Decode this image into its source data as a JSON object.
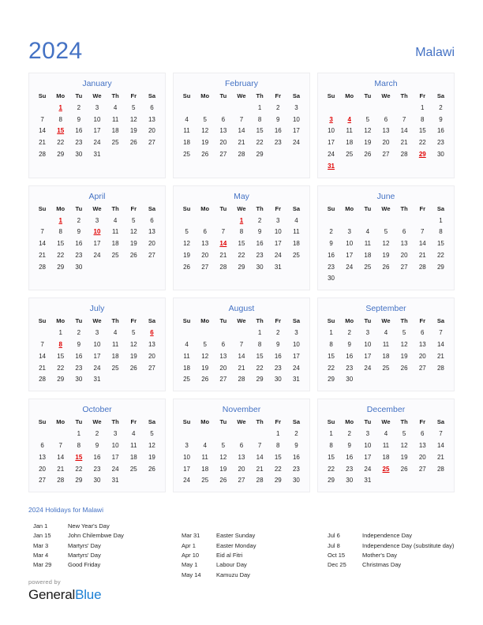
{
  "header": {
    "year": "2024",
    "country": "Malawi"
  },
  "colors": {
    "accent_blue": "#4472c4",
    "holiday_red": "#e00000",
    "brand_blue": "#1b7fd4",
    "card_bg": "#fbfbfd",
    "card_border": "#ededf0"
  },
  "weekday_headers": [
    "Su",
    "Mo",
    "Tu",
    "We",
    "Th",
    "Fr",
    "Sa"
  ],
  "months": [
    {
      "name": "January",
      "weeks": [
        [
          "",
          "1",
          "2",
          "3",
          "4",
          "5",
          "6"
        ],
        [
          "7",
          "8",
          "9",
          "10",
          "11",
          "12",
          "13"
        ],
        [
          "14",
          "15",
          "16",
          "17",
          "18",
          "19",
          "20"
        ],
        [
          "21",
          "22",
          "23",
          "24",
          "25",
          "26",
          "27"
        ],
        [
          "28",
          "29",
          "30",
          "31",
          "",
          "",
          ""
        ]
      ],
      "holidays": [
        "1",
        "15"
      ]
    },
    {
      "name": "February",
      "weeks": [
        [
          "",
          "",
          "",
          "",
          "1",
          "2",
          "3"
        ],
        [
          "4",
          "5",
          "6",
          "7",
          "8",
          "9",
          "10"
        ],
        [
          "11",
          "12",
          "13",
          "14",
          "15",
          "16",
          "17"
        ],
        [
          "18",
          "19",
          "20",
          "21",
          "22",
          "23",
          "24"
        ],
        [
          "25",
          "26",
          "27",
          "28",
          "29",
          "",
          ""
        ]
      ],
      "holidays": []
    },
    {
      "name": "March",
      "weeks": [
        [
          "",
          "",
          "",
          "",
          "",
          "1",
          "2"
        ],
        [
          "3",
          "4",
          "5",
          "6",
          "7",
          "8",
          "9"
        ],
        [
          "10",
          "11",
          "12",
          "13",
          "14",
          "15",
          "16"
        ],
        [
          "17",
          "18",
          "19",
          "20",
          "21",
          "22",
          "23"
        ],
        [
          "24",
          "25",
          "26",
          "27",
          "28",
          "29",
          "30"
        ],
        [
          "31",
          "",
          "",
          "",
          "",
          "",
          ""
        ]
      ],
      "holidays": [
        "3",
        "4",
        "29",
        "31"
      ]
    },
    {
      "name": "April",
      "weeks": [
        [
          "",
          "1",
          "2",
          "3",
          "4",
          "5",
          "6"
        ],
        [
          "7",
          "8",
          "9",
          "10",
          "11",
          "12",
          "13"
        ],
        [
          "14",
          "15",
          "16",
          "17",
          "18",
          "19",
          "20"
        ],
        [
          "21",
          "22",
          "23",
          "24",
          "25",
          "26",
          "27"
        ],
        [
          "28",
          "29",
          "30",
          "",
          "",
          "",
          ""
        ]
      ],
      "holidays": [
        "1",
        "10"
      ]
    },
    {
      "name": "May",
      "weeks": [
        [
          "",
          "",
          "",
          "1",
          "2",
          "3",
          "4"
        ],
        [
          "5",
          "6",
          "7",
          "8",
          "9",
          "10",
          "11"
        ],
        [
          "12",
          "13",
          "14",
          "15",
          "16",
          "17",
          "18"
        ],
        [
          "19",
          "20",
          "21",
          "22",
          "23",
          "24",
          "25"
        ],
        [
          "26",
          "27",
          "28",
          "29",
          "30",
          "31",
          ""
        ]
      ],
      "holidays": [
        "1",
        "14"
      ]
    },
    {
      "name": "June",
      "weeks": [
        [
          "",
          "",
          "",
          "",
          "",
          "",
          "1"
        ],
        [
          "2",
          "3",
          "4",
          "5",
          "6",
          "7",
          "8"
        ],
        [
          "9",
          "10",
          "11",
          "12",
          "13",
          "14",
          "15"
        ],
        [
          "16",
          "17",
          "18",
          "19",
          "20",
          "21",
          "22"
        ],
        [
          "23",
          "24",
          "25",
          "26",
          "27",
          "28",
          "29"
        ],
        [
          "30",
          "",
          "",
          "",
          "",
          "",
          ""
        ]
      ],
      "holidays": []
    },
    {
      "name": "July",
      "weeks": [
        [
          "",
          "1",
          "2",
          "3",
          "4",
          "5",
          "6"
        ],
        [
          "7",
          "8",
          "9",
          "10",
          "11",
          "12",
          "13"
        ],
        [
          "14",
          "15",
          "16",
          "17",
          "18",
          "19",
          "20"
        ],
        [
          "21",
          "22",
          "23",
          "24",
          "25",
          "26",
          "27"
        ],
        [
          "28",
          "29",
          "30",
          "31",
          "",
          "",
          ""
        ]
      ],
      "holidays": [
        "6",
        "8"
      ]
    },
    {
      "name": "August",
      "weeks": [
        [
          "",
          "",
          "",
          "",
          "1",
          "2",
          "3"
        ],
        [
          "4",
          "5",
          "6",
          "7",
          "8",
          "9",
          "10"
        ],
        [
          "11",
          "12",
          "13",
          "14",
          "15",
          "16",
          "17"
        ],
        [
          "18",
          "19",
          "20",
          "21",
          "22",
          "23",
          "24"
        ],
        [
          "25",
          "26",
          "27",
          "28",
          "29",
          "30",
          "31"
        ]
      ],
      "holidays": []
    },
    {
      "name": "September",
      "weeks": [
        [
          "1",
          "2",
          "3",
          "4",
          "5",
          "6",
          "7"
        ],
        [
          "8",
          "9",
          "10",
          "11",
          "12",
          "13",
          "14"
        ],
        [
          "15",
          "16",
          "17",
          "18",
          "19",
          "20",
          "21"
        ],
        [
          "22",
          "23",
          "24",
          "25",
          "26",
          "27",
          "28"
        ],
        [
          "29",
          "30",
          "",
          "",
          "",
          "",
          ""
        ]
      ],
      "holidays": []
    },
    {
      "name": "October",
      "weeks": [
        [
          "",
          "",
          "1",
          "2",
          "3",
          "4",
          "5"
        ],
        [
          "6",
          "7",
          "8",
          "9",
          "10",
          "11",
          "12"
        ],
        [
          "13",
          "14",
          "15",
          "16",
          "17",
          "18",
          "19"
        ],
        [
          "20",
          "21",
          "22",
          "23",
          "24",
          "25",
          "26"
        ],
        [
          "27",
          "28",
          "29",
          "30",
          "31",
          "",
          ""
        ]
      ],
      "holidays": [
        "15"
      ]
    },
    {
      "name": "November",
      "weeks": [
        [
          "",
          "",
          "",
          "",
          "",
          "1",
          "2"
        ],
        [
          "3",
          "4",
          "5",
          "6",
          "7",
          "8",
          "9"
        ],
        [
          "10",
          "11",
          "12",
          "13",
          "14",
          "15",
          "16"
        ],
        [
          "17",
          "18",
          "19",
          "20",
          "21",
          "22",
          "23"
        ],
        [
          "24",
          "25",
          "26",
          "27",
          "28",
          "29",
          "30"
        ]
      ],
      "holidays": []
    },
    {
      "name": "December",
      "weeks": [
        [
          "1",
          "2",
          "3",
          "4",
          "5",
          "6",
          "7"
        ],
        [
          "8",
          "9",
          "10",
          "11",
          "12",
          "13",
          "14"
        ],
        [
          "15",
          "16",
          "17",
          "18",
          "19",
          "20",
          "21"
        ],
        [
          "22",
          "23",
          "24",
          "25",
          "26",
          "27",
          "28"
        ],
        [
          "29",
          "30",
          "31",
          "",
          "",
          "",
          ""
        ]
      ],
      "holidays": [
        "25"
      ]
    }
  ],
  "holidays_section": {
    "title": "2024 Holidays for Malawi",
    "columns": [
      [
        {
          "date": "Jan 1",
          "name": "New Year's Day"
        },
        {
          "date": "Jan 15",
          "name": "John Chilembwe Day"
        },
        {
          "date": "Mar 3",
          "name": "Martyrs' Day"
        },
        {
          "date": "Mar 4",
          "name": "Martyrs' Day"
        },
        {
          "date": "Mar 29",
          "name": "Good Friday"
        }
      ],
      [
        {
          "date": "Mar 31",
          "name": "Easter Sunday"
        },
        {
          "date": "Apr 1",
          "name": "Easter Monday"
        },
        {
          "date": "Apr 10",
          "name": "Eid al Fitri"
        },
        {
          "date": "May 1",
          "name": "Labour Day"
        },
        {
          "date": "May 14",
          "name": "Kamuzu Day"
        }
      ],
      [
        {
          "date": "Jul 6",
          "name": "Independence Day"
        },
        {
          "date": "Jul 8",
          "name": "Independence Day (substitute day)"
        },
        {
          "date": "Oct 15",
          "name": "Mother's Day"
        },
        {
          "date": "Dec 25",
          "name": "Christmas Day"
        }
      ]
    ],
    "column_offsets": [
      0,
      1,
      1
    ]
  },
  "footer": {
    "powered_by": "powered by",
    "brand_first": "General",
    "brand_second": "Blue"
  }
}
